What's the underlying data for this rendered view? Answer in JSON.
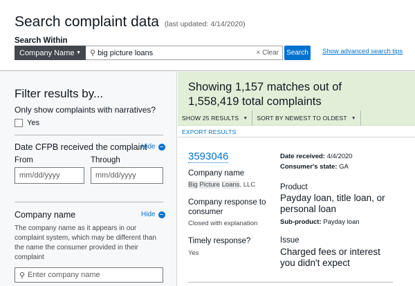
{
  "header": {
    "title": "Search complaint data",
    "last_updated": "(last updated: 4/14/2020)",
    "search_within_label": "Search Within",
    "field_select_value": "Company Name",
    "search_value": "big picture loans",
    "clear_label": "× Clear",
    "search_button": "Search",
    "advanced_tips_link": "Show advanced search tips"
  },
  "filters": {
    "title": "Filter results by...",
    "narratives_question": "Only show complaints with narratives?",
    "yes_label": "Yes",
    "date_section_title": "Date CFPB received the complaint",
    "hide_label": "Hide",
    "from_label": "From",
    "through_label": "Through",
    "from_placeholder": "mm/dd/yyyy",
    "through_placeholder": "mm/dd/yyyy",
    "company_section_title": "Company name",
    "company_description": "The company name as it appears in our complaint system, which may be different than the name the consumer provided in their complaint",
    "company_placeholder": "Enter company name"
  },
  "results": {
    "showing_text": "Showing 1,157 matches out of 1,558,419 total complaints",
    "show_results_dropdown": "SHOW 25 RESULTS",
    "sort_dropdown": "SORT BY NEWEST TO OLDEST",
    "export_link": "EXPORT RESULTS"
  },
  "complaint": {
    "id": "3593046",
    "company_name_label": "Company name",
    "company_name_highlight_1": "Big",
    "company_name_highlight_2": "Picture",
    "company_name_highlight_3": "Loans",
    "company_name_rest": ", LLC",
    "company_response_label": "Company response to consumer",
    "company_response_value": "Closed with explanation",
    "timely_label": "Timely response?",
    "timely_value": "Yes",
    "date_received_label": "Date received:",
    "date_received_value": "4/4/2020",
    "state_label": "Consumer's state:",
    "state_value": "GA",
    "product_label": "Product",
    "product_value": "Payday loan, title loan, or personal loan",
    "subproduct_label": "Sub-product:",
    "subproduct_value": "Payday loan",
    "issue_label": "Issue",
    "issue_value": "Charged fees or interest you didn't expect"
  },
  "colors": {
    "accent": "#0072ce",
    "results_header_bg": "#e2efd8",
    "filter_bg": "#f7f8f9",
    "select_bg": "#43484e"
  }
}
